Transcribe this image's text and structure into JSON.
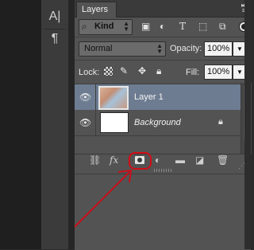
{
  "tools": {
    "character_icon": "A|",
    "paragraph_icon": "¶"
  },
  "panel": {
    "tab_label": "Layers",
    "tab_close": "×",
    "collapse_glyph": "▸▸",
    "menu_glyph": "≡"
  },
  "filter": {
    "kind_label": "Kind",
    "kind_icon": "search-icon"
  },
  "blend": {
    "mode": "Normal",
    "opacity_label": "Opacity:",
    "opacity_value": "100%"
  },
  "lock": {
    "label": "Lock:",
    "fill_label": "Fill:",
    "fill_value": "100%"
  },
  "layers": [
    {
      "name": "Layer 1",
      "selected": true,
      "visible": true
    },
    {
      "name": "Background",
      "selected": false,
      "visible": true,
      "locked": true
    }
  ],
  "bottom_toolbar": {
    "icons": [
      "link-icon",
      "fx-icon",
      "add-mask-icon",
      "adjustment-icon",
      "folder-icon",
      "new-layer-icon",
      "trash-icon"
    ],
    "fx_label": "fx"
  },
  "colors": {
    "selected_row": "#6d7c91",
    "panel_bg": "#535353",
    "highlight": "#d10e16"
  }
}
